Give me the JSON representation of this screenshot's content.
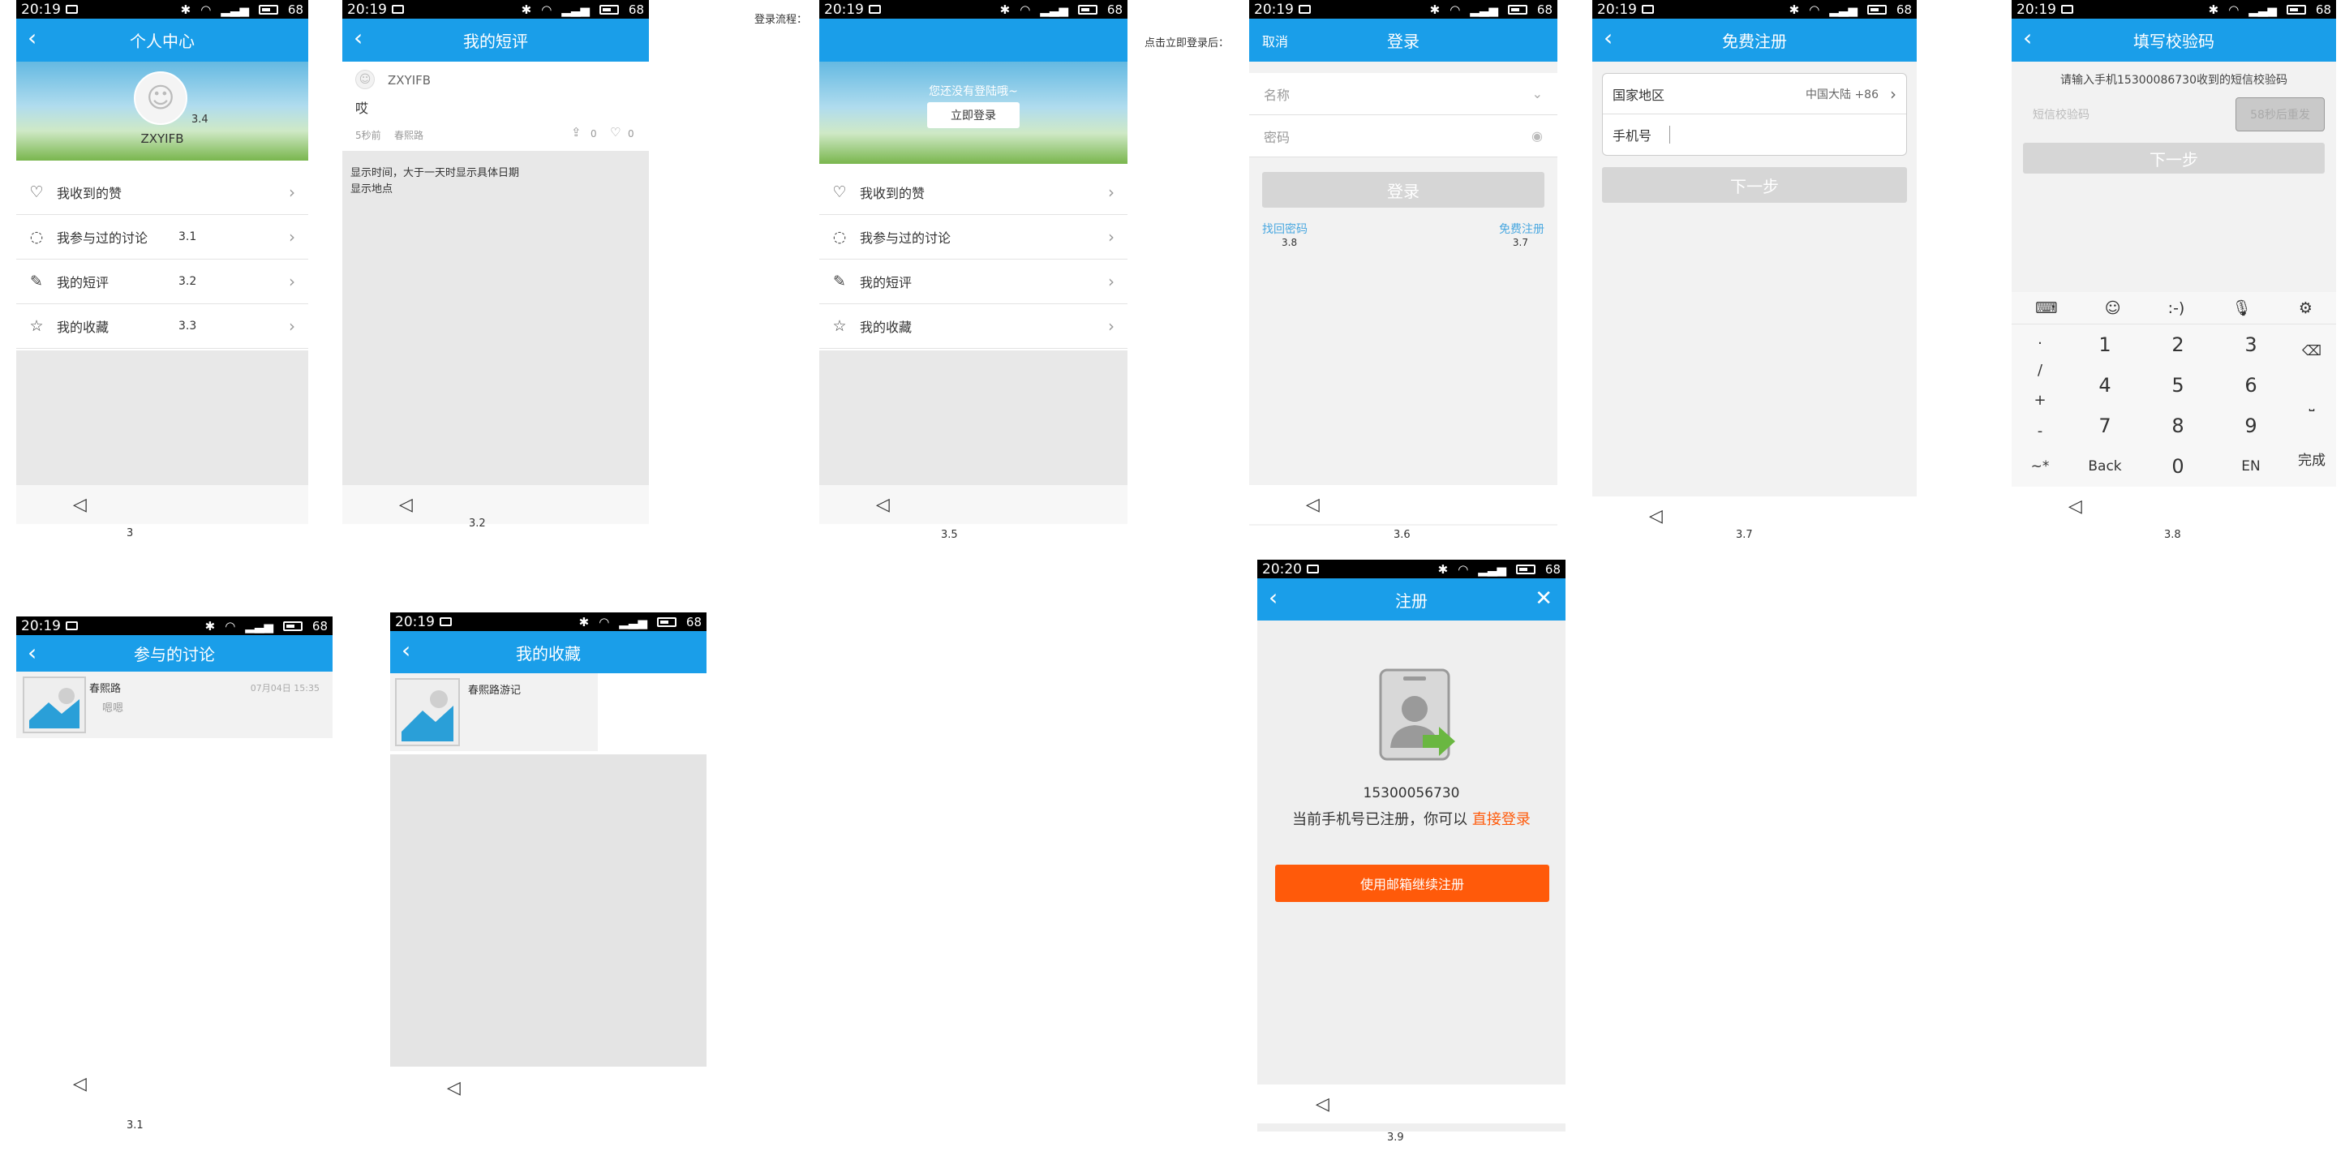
{
  "status": {
    "time": "20:19",
    "time2": "20:20",
    "battery": "68"
  },
  "labels": {
    "login_flow": "登录流程：",
    "after_login": "点击立即登录后："
  },
  "s3": {
    "title": "个人中心",
    "user": "ZXYIFB",
    "avatar_tag": "3.4",
    "caption": "3",
    "menu": [
      {
        "label": "我收到的赞",
        "num": ""
      },
      {
        "label": "我参与过的讨论",
        "num": "3.1"
      },
      {
        "label": "我的短评",
        "num": "3.2"
      },
      {
        "label": "我的收藏",
        "num": "3.3"
      }
    ]
  },
  "s32": {
    "title": "我的短评",
    "user": "ZXYIFB",
    "text": "哎",
    "time": "5秒前",
    "place": "春熙路",
    "share_count": "0",
    "like_count": "0",
    "note1": "显示时间，大于一天时显示具体日期",
    "note2": "显示地点",
    "caption": "3.2"
  },
  "s35": {
    "prompt": "您还没有登陆哦~",
    "login_btn": "立即登录",
    "caption": "3.5",
    "menu": [
      "我收到的赞",
      "我参与过的讨论",
      "我的短评",
      "我的收藏"
    ]
  },
  "s36": {
    "cancel": "取消",
    "title": "登录",
    "name_placeholder": "名称",
    "pwd_placeholder": "密码",
    "login_btn": "登录",
    "forgot": "找回密码",
    "forgot_ref": "3.8",
    "register": "免费注册",
    "register_ref": "3.7",
    "caption": "3.6"
  },
  "s37": {
    "title": "免费注册",
    "region_label": "国家地区",
    "region_value": "中国大陆 +86",
    "phone_label": "手机号",
    "next": "下一步",
    "caption": "3.7"
  },
  "s38": {
    "title": "填写校验码",
    "instruction": "请输入手机15300086730收到的短信校验码",
    "code_placeholder": "短信校验码",
    "resend": "58秒后重发",
    "next": "下一步",
    "caption": "3.8",
    "kb_top": [
      "⌨",
      "☺",
      ":-)",
      "🎙",
      "⚙"
    ],
    "kb_left": [
      ".",
      "/",
      "+",
      "-"
    ],
    "kb_rows": [
      [
        "1",
        "2",
        "3"
      ],
      [
        "4",
        "5",
        "6"
      ],
      [
        "7",
        "8",
        "9"
      ],
      [
        "Back",
        "0",
        "EN"
      ]
    ],
    "kb_sym": "~*",
    "done": "完成"
  },
  "s31": {
    "title": "参与的讨论",
    "name": "春熙路",
    "date": "07月04日 15:35",
    "text": "嗯嗯",
    "caption": "3.1"
  },
  "s33": {
    "title": "我的收藏",
    "name": "春熙路游记"
  },
  "s39": {
    "title": "注册",
    "phone": "15300056730",
    "msg": "当前手机号已注册，你可以 ",
    "link": "直接登录",
    "btn": "使用邮箱继续注册",
    "caption": "3.9"
  },
  "colors": {
    "primary": "#1a9ee9",
    "orange": "#ff5a0a",
    "link": "#4aa8e0"
  }
}
